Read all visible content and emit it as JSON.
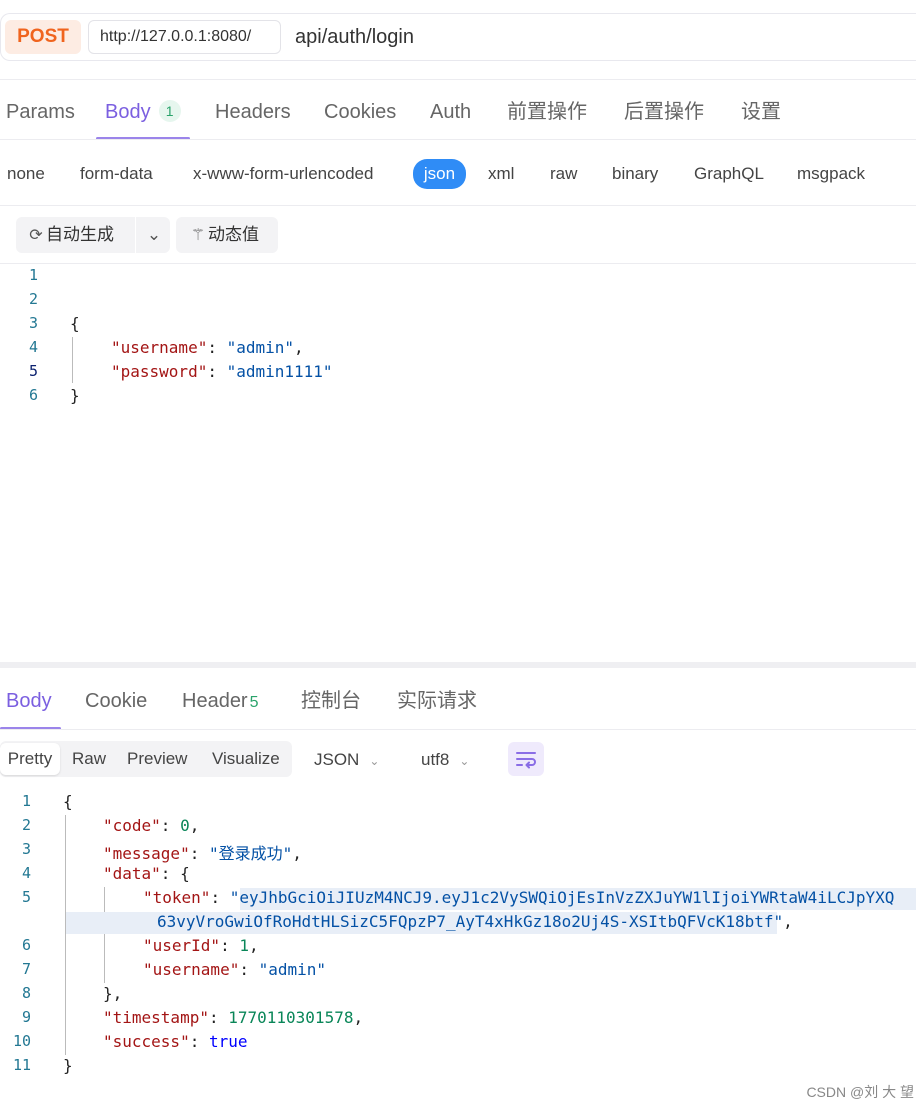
{
  "request": {
    "method": "POST",
    "base_url": "http://127.0.0.1:8080/",
    "path": "api/auth/login"
  },
  "request_tabs": [
    {
      "label": "Params"
    },
    {
      "label": "Body",
      "badge": "1",
      "active": true
    },
    {
      "label": "Headers"
    },
    {
      "label": "Cookies"
    },
    {
      "label": "Auth"
    },
    {
      "label": "前置操作"
    },
    {
      "label": "后置操作"
    },
    {
      "label": "设置"
    }
  ],
  "body_types": [
    "none",
    "form-data",
    "x-www-form-urlencoded",
    "json",
    "xml",
    "raw",
    "binary",
    "GraphQL",
    "msgpack"
  ],
  "body_type_selected": "json",
  "toolbar": {
    "auto_generate_label": "自动生成",
    "dynamic_value_label": "动态值"
  },
  "request_body": {
    "line_numbers": [
      "1",
      "2",
      "3",
      "4",
      "5",
      "6"
    ],
    "brace_open": "{",
    "brace_close": "}",
    "username_key": "\"username\"",
    "username_value": "\"admin\"",
    "password_key": "\"password\"",
    "password_value": "\"admin1111\""
  },
  "response_tabs": [
    {
      "label": "Body",
      "active": true
    },
    {
      "label": "Cookie"
    },
    {
      "label": "Header",
      "badge": "5"
    },
    {
      "label": "控制台"
    },
    {
      "label": "实际请求"
    }
  ],
  "view_modes": [
    "Pretty",
    "Raw",
    "Preview",
    "Visualize"
  ],
  "view_mode_selected": "Pretty",
  "format_select": "JSON",
  "encoding_select": "utf8",
  "response_body": {
    "line_numbers": [
      "1",
      "2",
      "3",
      "4",
      "5",
      "",
      "6",
      "7",
      "8",
      "9",
      "10",
      "11"
    ],
    "code_key": "\"code\"",
    "code_value": "0",
    "message_key": "\"message\"",
    "message_value": "\"登录成功\"",
    "data_key": "\"data\"",
    "token_key": "\"token\"",
    "token_line1": "eyJhbGciOiJIUzM4NCJ9.eyJ1c2VySWQiOjEsInVzZXJuYW1lIjoiYWRtaW4iLCJpYXQ",
    "token_line2": "63vyVroGwiOfRoHdtHLSizC5FQpzP7_AyT4xHkGz18o2Uj4S-XSItbQFVcK18btf",
    "userid_key": "\"userId\"",
    "userid_value": "1",
    "username_key": "\"username\"",
    "username_value": "\"admin\"",
    "timestamp_key": "\"timestamp\"",
    "timestamp_value": "1770110301578",
    "success_key": "\"success\"",
    "success_value": "true"
  },
  "watermark": "CSDN @刘 大 望"
}
